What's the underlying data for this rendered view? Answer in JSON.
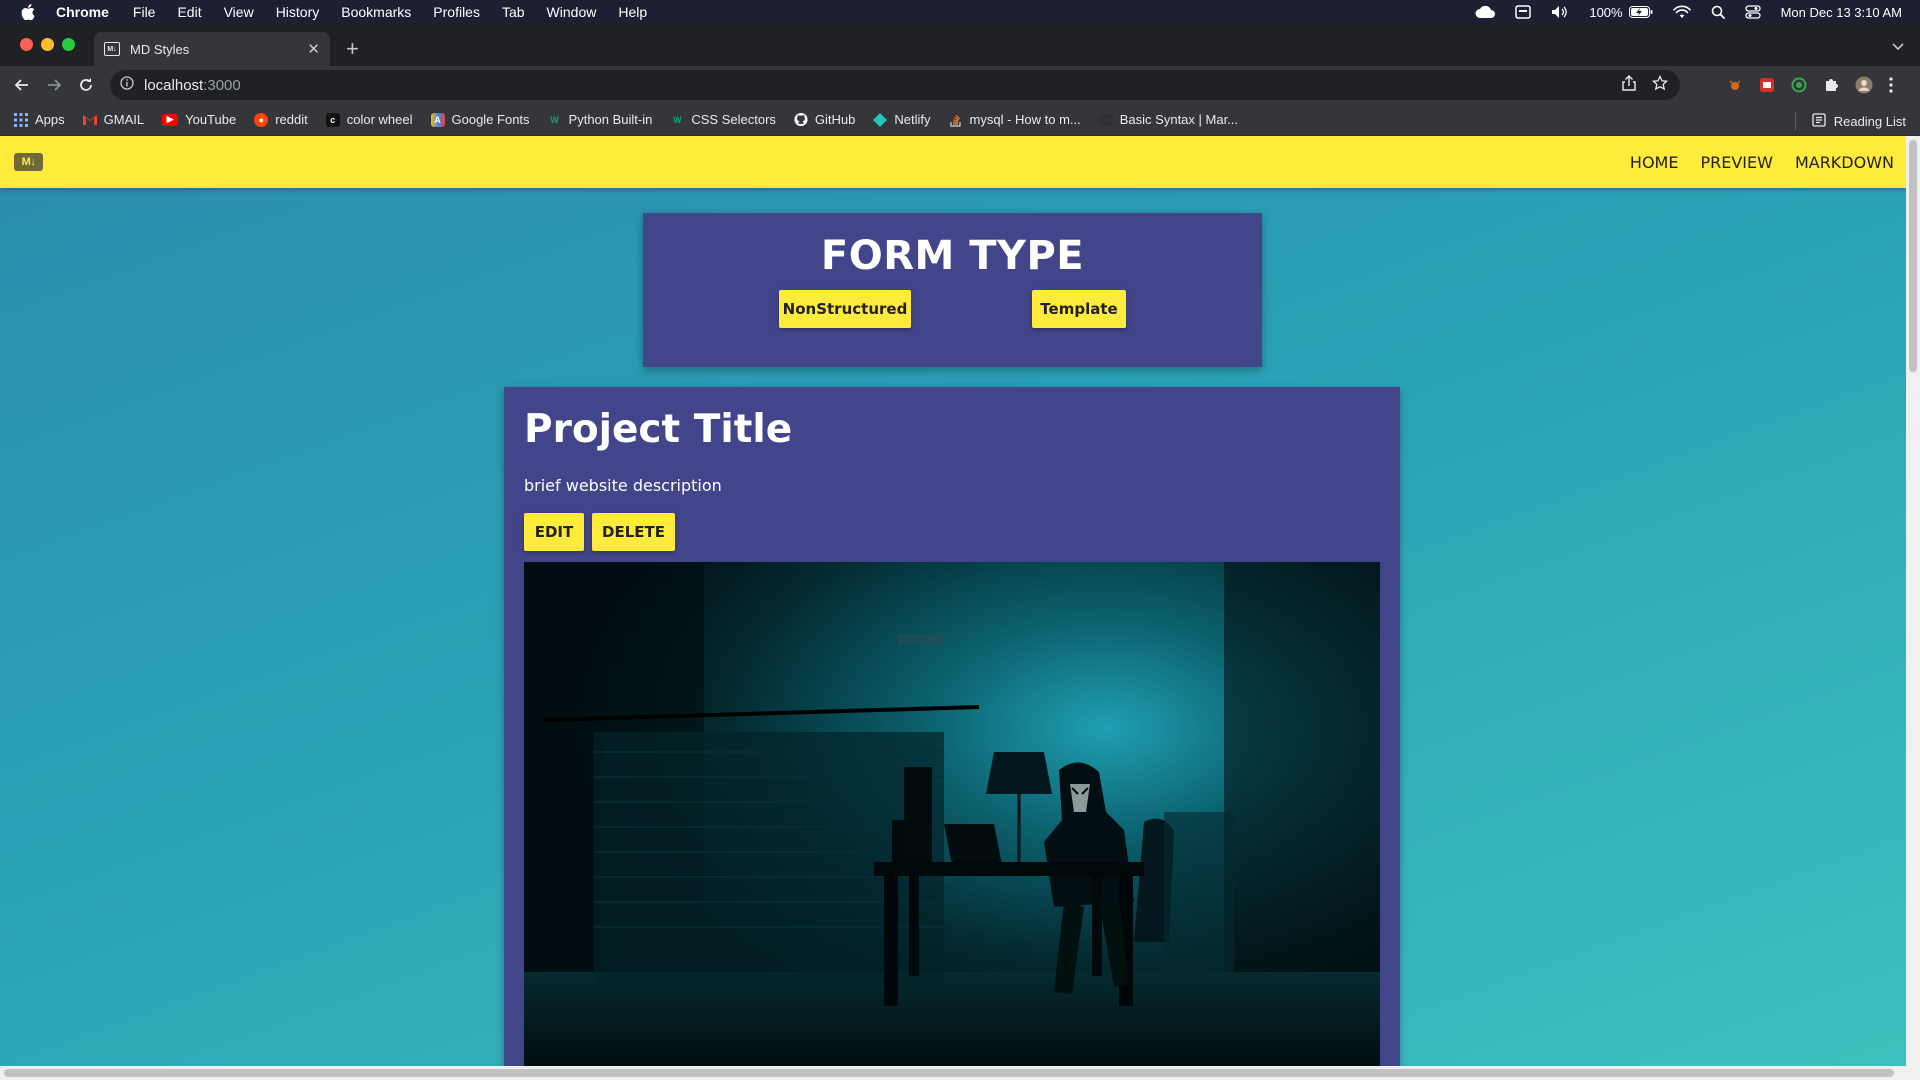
{
  "menubar": {
    "app_name": "Chrome",
    "menus": [
      "File",
      "Edit",
      "View",
      "History",
      "Bookmarks",
      "Profiles",
      "Tab",
      "Window",
      "Help"
    ],
    "battery": "100%",
    "clock": "Mon Dec 13  3:10 AM"
  },
  "browser": {
    "tab_title": "MD Styles",
    "tab_favicon": "M↓",
    "url_host": "localhost",
    "url_port": ":3000",
    "bookmarks": [
      {
        "label": "Apps",
        "icon": "apps-grid-icon",
        "color": "#e8eaed"
      },
      {
        "label": "GMAIL",
        "icon": "gmail-icon",
        "color": "#ea4335"
      },
      {
        "label": "YouTube",
        "icon": "youtube-icon",
        "color": "#ff0000"
      },
      {
        "label": "reddit",
        "icon": "reddit-icon",
        "color": "#ff4500"
      },
      {
        "label": "color wheel",
        "icon": "color-wheel-icon",
        "color": "#1b1b1b"
      },
      {
        "label": "Google Fonts",
        "icon": "google-fonts-icon",
        "color": "#4285f4"
      },
      {
        "label": "Python Built-in",
        "icon": "w3schools-icon",
        "color": "#04aa6d"
      },
      {
        "label": "CSS Selectors",
        "icon": "w3schools-icon",
        "color": "#04aa6d"
      },
      {
        "label": "GitHub",
        "icon": "github-icon",
        "color": "#ffffff"
      },
      {
        "label": "Netlify",
        "icon": "netlify-icon",
        "color": "#20c6b7"
      },
      {
        "label": "mysql - How to m...",
        "icon": "stackoverflow-icon",
        "color": "#f48024"
      },
      {
        "label": "Basic Syntax | Mar...",
        "icon": "markdown-guide-icon",
        "color": "#2f3033"
      }
    ],
    "reading_list": "Reading List"
  },
  "site": {
    "logo": "M↓",
    "nav": {
      "home": "HOME",
      "preview": "PREVIEW",
      "markdown": "MARKDOWN"
    },
    "form_type": {
      "title": "FORM TYPE",
      "nonstructured": "NonStructured",
      "template": "Template"
    },
    "project": {
      "title": "Project Title",
      "description": "brief website description",
      "edit": "EDIT",
      "delete": "DELETE"
    }
  },
  "colors": {
    "nav_yellow": "#ffeb3b",
    "card_purple": "#43458b",
    "bg_teal_start": "#2b8cad",
    "bg_teal_end": "#3ec1bf"
  }
}
